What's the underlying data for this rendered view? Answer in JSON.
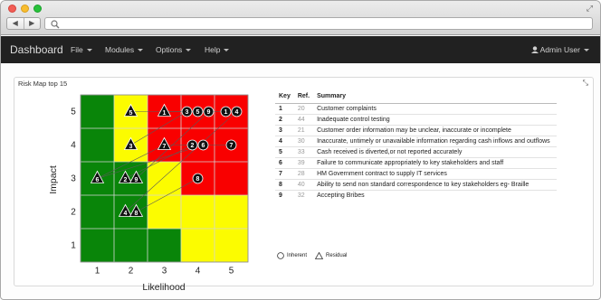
{
  "browser": {
    "url": ""
  },
  "navbar": {
    "brand": "Dashboard",
    "menus": [
      "File",
      "Modules",
      "Options",
      "Help"
    ],
    "user": "Admin User"
  },
  "panel": {
    "title": "Risk Map top 15"
  },
  "matrix": {
    "y_axis_label": "Impact",
    "x_axis_label": "Likelihood",
    "x_ticks": [
      "1",
      "2",
      "3",
      "4",
      "5"
    ],
    "y_ticks": [
      "1",
      "2",
      "3",
      "4",
      "5"
    ],
    "colors": {
      "green": "#098509",
      "yellow": "#fcfc00",
      "red": "#f90000"
    },
    "cell_colors": [
      [
        "green",
        "yellow",
        "red",
        "red",
        "red"
      ],
      [
        "green",
        "yellow",
        "red",
        "red",
        "red"
      ],
      [
        "green",
        "green",
        "yellow",
        "red",
        "red"
      ],
      [
        "green",
        "green",
        "yellow",
        "yellow",
        "yellow"
      ],
      [
        "green",
        "green",
        "green",
        "yellow",
        "yellow"
      ]
    ],
    "markers": [
      {
        "key": 1,
        "inherent": [
          5,
          5
        ],
        "residual": [
          3,
          5
        ]
      },
      {
        "key": 2,
        "inherent": [
          4,
          4
        ],
        "residual": [
          2,
          3
        ]
      },
      {
        "key": 3,
        "inherent": [
          4,
          5
        ],
        "residual": [
          2,
          4
        ]
      },
      {
        "key": 4,
        "inherent": [
          5,
          5
        ],
        "residual": [
          2,
          2
        ]
      },
      {
        "key": 5,
        "inherent": [
          4,
          5
        ],
        "residual": [
          2,
          5
        ]
      },
      {
        "key": 6,
        "inherent": [
          4,
          4
        ],
        "residual": [
          1,
          3
        ]
      },
      {
        "key": 7,
        "inherent": [
          5,
          4
        ],
        "residual": [
          3,
          4
        ]
      },
      {
        "key": 8,
        "inherent": [
          4,
          3
        ],
        "residual": [
          2,
          2
        ]
      },
      {
        "key": 9,
        "inherent": [
          4,
          5
        ],
        "residual": [
          2,
          3
        ]
      }
    ],
    "extra_lines": [
      [
        [
          3,
          4
        ],
        [
          1,
          3
        ]
      ]
    ],
    "legend": {
      "inherent": "Inherent",
      "residual": "Residual"
    }
  },
  "table": {
    "headers": [
      "Key",
      "Ref.",
      "Summary"
    ],
    "rows": [
      {
        "key": "1",
        "ref": "20",
        "summary": "Customer complaints"
      },
      {
        "key": "2",
        "ref": "44",
        "summary": "Inadequate control testing"
      },
      {
        "key": "3",
        "ref": "21",
        "summary": "Customer order information may be unclear, inaccurate or incomplete"
      },
      {
        "key": "4",
        "ref": "30",
        "summary": "Inaccurate, untimely or unavailable information regarding cash inflows and outflows"
      },
      {
        "key": "5",
        "ref": "33",
        "summary": "Cash received is diverted,or not reported accurately"
      },
      {
        "key": "6",
        "ref": "39",
        "summary": "Failure to communicate appropriately to key stakeholders and staff"
      },
      {
        "key": "7",
        "ref": "28",
        "summary": "HM Government contract to supply IT services"
      },
      {
        "key": "8",
        "ref": "40",
        "summary": "Ability to send non standard correspondence to key stakeholders eg- Braille"
      },
      {
        "key": "9",
        "ref": "32",
        "summary": "Accepting Bribes"
      }
    ]
  }
}
